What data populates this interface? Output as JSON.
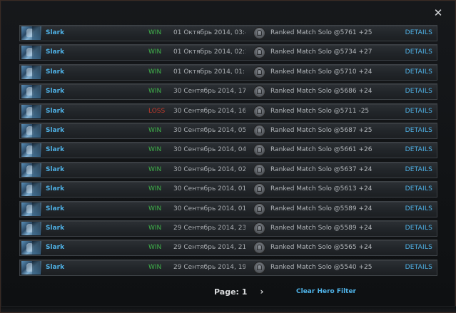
{
  "window": {
    "close_glyph": "✕"
  },
  "matches": [
    {
      "hero": "Slark",
      "result": "WIN",
      "result_key": "win",
      "date": "01 Октябрь 2014, 03:40:",
      "mode": "Ranked Match Solo @5761 +25",
      "details": "DETAILS"
    },
    {
      "hero": "Slark",
      "result": "WIN",
      "result_key": "win",
      "date": "01 Октябрь 2014, 02:29:",
      "mode": "Ranked Match Solo @5734 +27",
      "details": "DETAILS"
    },
    {
      "hero": "Slark",
      "result": "WIN",
      "result_key": "win",
      "date": "01 Октябрь 2014, 01:11:",
      "mode": "Ranked Match Solo @5710 +24",
      "details": "DETAILS"
    },
    {
      "hero": "Slark",
      "result": "WIN",
      "result_key": "win",
      "date": "30 Сентябрь 2014, 17:32",
      "mode": "Ranked Match Solo @5686 +24",
      "details": "DETAILS"
    },
    {
      "hero": "Slark",
      "result": "LOSS",
      "result_key": "loss",
      "date": "30 Сентябрь 2014, 16:36",
      "mode": "Ranked Match Solo @5711 -25",
      "details": "DETAILS"
    },
    {
      "hero": "Slark",
      "result": "WIN",
      "result_key": "win",
      "date": "30 Сентябрь 2014, 05:50",
      "mode": "Ranked Match Solo @5687 +25",
      "details": "DETAILS"
    },
    {
      "hero": "Slark",
      "result": "WIN",
      "result_key": "win",
      "date": "30 Сентябрь 2014, 04:30",
      "mode": "Ranked Match Solo @5661 +26",
      "details": "DETAILS"
    },
    {
      "hero": "Slark",
      "result": "WIN",
      "result_key": "win",
      "date": "30 Сентябрь 2014, 02:50",
      "mode": "Ranked Match Solo @5637 +24",
      "details": "DETAILS"
    },
    {
      "hero": "Slark",
      "result": "WIN",
      "result_key": "win",
      "date": "30 Сентябрь 2014, 01:58",
      "mode": "Ranked Match Solo @5613 +24",
      "details": "DETAILS"
    },
    {
      "hero": "Slark",
      "result": "WIN",
      "result_key": "win",
      "date": "30 Сентябрь 2014, 01:17",
      "mode": "Ranked Match Solo @5589 +24",
      "details": "DETAILS"
    },
    {
      "hero": "Slark",
      "result": "WIN",
      "result_key": "win",
      "date": "29 Сентябрь 2014, 23:14",
      "mode": "Ranked Match Solo @5589 +24",
      "details": "DETAILS"
    },
    {
      "hero": "Slark",
      "result": "WIN",
      "result_key": "win",
      "date": "29 Сентябрь 2014, 21:42",
      "mode": "Ranked Match Solo @5565 +24",
      "details": "DETAILS"
    },
    {
      "hero": "Slark",
      "result": "WIN",
      "result_key": "win",
      "date": "29 Сентябрь 2014, 19:57",
      "mode": "Ranked Match Solo @5540 +25",
      "details": "DETAILS"
    }
  ],
  "footer": {
    "page_label": "Page: 1",
    "next_glyph": "›",
    "clear_filter_label": "Clear Hero Filter"
  },
  "colors": {
    "accent_blue": "#4fb3e8",
    "win_green": "#3fb24a",
    "loss_red": "#c0392b"
  },
  "icons": {
    "hero_portrait": "hero-portrait-icon",
    "game_mode": "ranked-mode-icon",
    "close": "close-icon",
    "next": "chevron-right-icon"
  }
}
